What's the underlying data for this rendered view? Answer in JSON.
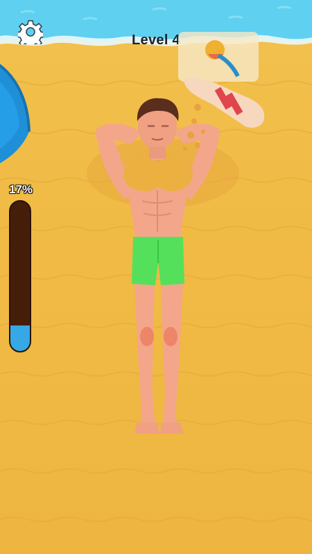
{
  "hud": {
    "level_label": "Level 4",
    "progress_label": "17%",
    "progress": 0.17
  },
  "icons": {
    "settings": "gear-icon"
  },
  "colors": {
    "sand": "#f0bb45",
    "sea": "#5fd0ef",
    "bar_track": "#451e0a",
    "bar_fill": "#36a8e6",
    "shorts": "#55e05c",
    "skin": "#f3a68a",
    "sunburn": "#e8694c",
    "umbrella": "#1f8fd8"
  }
}
